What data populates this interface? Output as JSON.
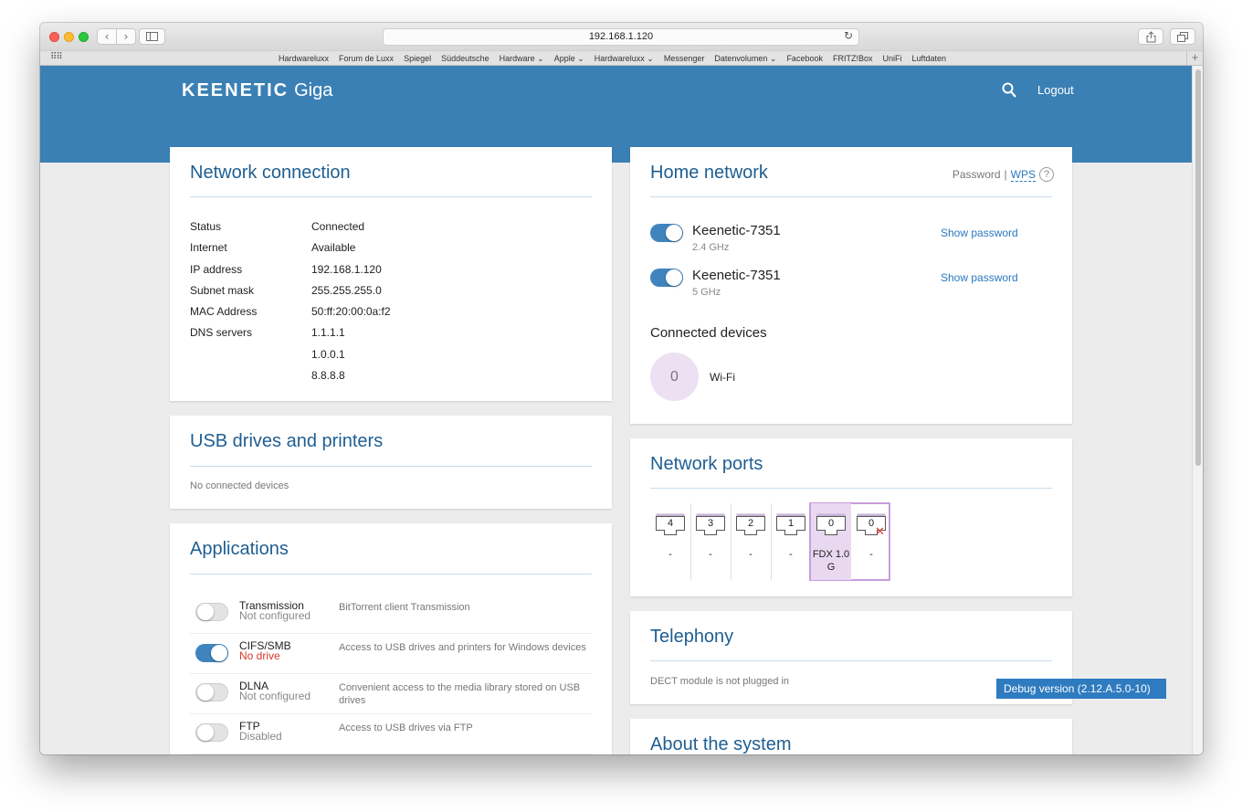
{
  "browser": {
    "url": "192.168.1.120",
    "bookmarks": [
      "Hardwareluxx",
      "Forum de Luxx",
      "Spiegel",
      "Süddeutsche",
      "Hardware ⌄",
      "Apple ⌄",
      "Hardwareluxx ⌄",
      "Messenger",
      "Datenvolumen ⌄",
      "Facebook",
      "FRITZ!Box",
      "UniFi",
      "Luftdaten"
    ]
  },
  "header": {
    "brand": "KEENETIC",
    "model": "Giga",
    "logout": "Logout"
  },
  "network_connection": {
    "title": "Network connection",
    "rows": [
      {
        "k": "Status",
        "v": "Connected"
      },
      {
        "k": "Internet",
        "v": "Available"
      },
      {
        "k": "IP address",
        "v": "192.168.1.120"
      },
      {
        "k": "Subnet mask",
        "v": "255.255.255.0"
      },
      {
        "k": "MAC Address",
        "v": "50:ff:20:00:0a:f2"
      },
      {
        "k": "DNS servers",
        "v": "1.1.1.1"
      },
      {
        "k": "",
        "v": "1.0.0.1"
      },
      {
        "k": "",
        "v": "8.8.8.8"
      }
    ]
  },
  "usb": {
    "title": "USB drives and printers",
    "empty": "No connected devices"
  },
  "applications": {
    "title": "Applications",
    "items": [
      {
        "name": "Transmission",
        "state": "Not configured",
        "desc": "BitTorrent client Transmission",
        "on": false
      },
      {
        "name": "CIFS/SMB",
        "state": "No drive",
        "desc": "Access to USB drives and printers for Windows devices",
        "on": true
      },
      {
        "name": "DLNA",
        "state": "Not configured",
        "desc": "Convenient access to the media library stored on USB drives",
        "on": false
      },
      {
        "name": "FTP",
        "state": "Disabled",
        "desc": "Access to USB drives via FTP",
        "on": false
      }
    ]
  },
  "home_network": {
    "title": "Home network",
    "password_link": "Password",
    "separator": "|",
    "wps_link": "WPS",
    "help": "?",
    "wifi": [
      {
        "ssid": "Keenetic-7351",
        "band": "2.4 GHz",
        "action": "Show password"
      },
      {
        "ssid": "Keenetic-7351",
        "band": "5 GHz",
        "action": "Show password"
      }
    ],
    "devices_title": "Connected devices",
    "devices_count": "0",
    "devices_label": "Wi-Fi"
  },
  "network_ports": {
    "title": "Network ports",
    "ports": [
      {
        "num": "4",
        "label": "-"
      },
      {
        "num": "3",
        "label": "-"
      },
      {
        "num": "2",
        "label": "-"
      },
      {
        "num": "1",
        "label": "-"
      },
      {
        "num": "0",
        "label": "FDX 1.0 G"
      },
      {
        "num": "0",
        "label": "-"
      }
    ]
  },
  "telephony": {
    "title": "Telephony",
    "status": "DECT module is not plugged in"
  },
  "about": {
    "title": "About the system"
  },
  "debug_badge": "Debug version (2.12.A.5.0-10)",
  "colors": {
    "brand_blue": "#3b80b5",
    "title_blue": "#1f5e92",
    "link_blue": "#2a78c0",
    "error_red": "#d63a2f",
    "port_active": "#e8d8f0"
  }
}
